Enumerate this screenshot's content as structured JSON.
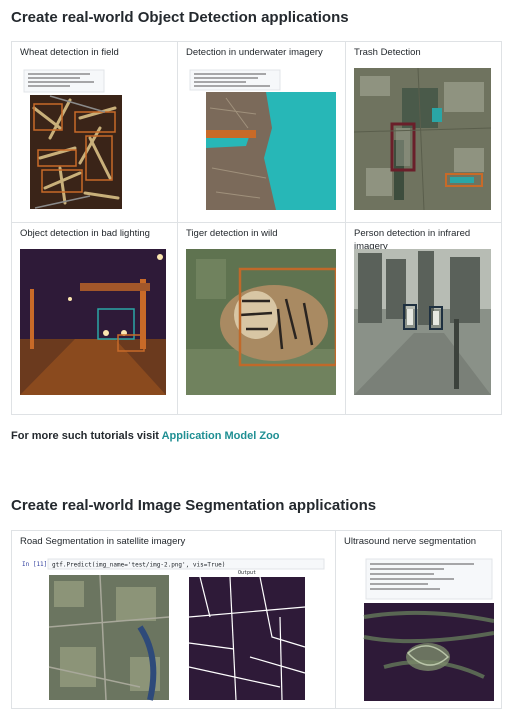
{
  "object_detection": {
    "title": "Create real-world Object Detection applications",
    "cells": [
      {
        "label": "Wheat detection in field",
        "icon": "wheat-field-image"
      },
      {
        "label": "Detection in underwater imagery",
        "icon": "underwater-image"
      },
      {
        "label": "Trash Detection",
        "icon": "aerial-trash-image"
      },
      {
        "label": "Object detection in bad lighting",
        "icon": "night-street-image"
      },
      {
        "label": "Tiger detection in wild",
        "icon": "tiger-image"
      },
      {
        "label": "Person detection in infrared imagery",
        "icon": "infrared-image"
      }
    ]
  },
  "more": {
    "prefix": "For more such tutorials visit ",
    "link_label": "Application Model Zoo"
  },
  "segmentation": {
    "title": "Create real-world Image Segmentation applications",
    "cells": [
      {
        "label": "Road Segmentation in satellite imagery",
        "icon": "road-satellite-image"
      },
      {
        "label": "Ultrasound nerve segmentation",
        "icon": "ultrasound-image"
      }
    ],
    "code_prompt": "In [11]:",
    "road_code": "gtf.Predict(img_name='test/img-2.png', vis=True)",
    "road_mask_caption": "Output"
  },
  "colors": {
    "link": "#1f8f93",
    "border": "#dfe2e5",
    "text": "#24292e",
    "teal_box": "#27b7b7",
    "orange_box": "#c0692a",
    "person_box": "#1e3040"
  }
}
